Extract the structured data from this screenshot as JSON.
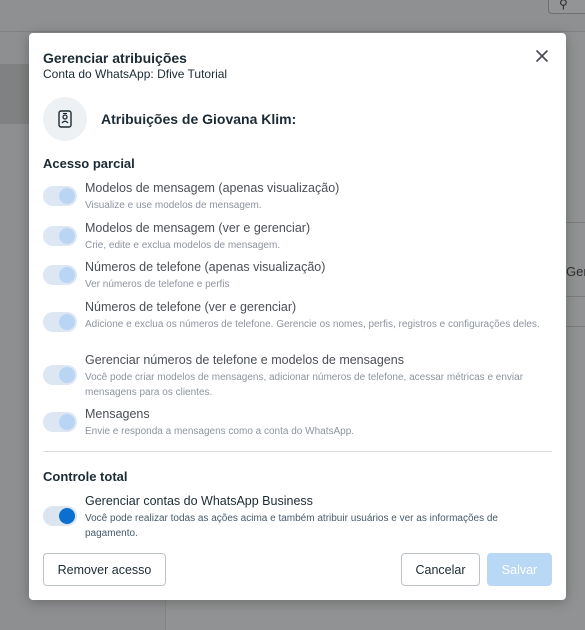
{
  "background": {
    "search_icon": "search-icon",
    "right_text": "Gerenc"
  },
  "modal": {
    "title": "Gerenciar atribuições",
    "subtitle": "Conta do WhatsApp: Dfive Tutorial",
    "close_icon": "close-icon",
    "avatar_icon": "id-badge-icon",
    "user_heading": "Atribuições de Giovana Klim:",
    "partial_access": {
      "title": "Acesso parcial",
      "items": [
        {
          "label": "Modelos de mensagem (apenas visualização)",
          "description": "Visualize e use modelos de mensagem.",
          "enabled": true
        },
        {
          "label": "Modelos de mensagem (ver e gerenciar)",
          "description": "Crie, edite e exclua modelos de mensagem.",
          "enabled": true
        },
        {
          "label": "Números de telefone (apenas visualização)",
          "description": "Ver números de telefone e perfis",
          "enabled": true
        },
        {
          "label": "Números de telefone (ver e gerenciar)",
          "description": "Adicione e exclua os números de telefone. Gerencie os nomes, perfis, registros e configurações deles.",
          "enabled": true
        },
        {
          "label": "Gerenciar números de telefone e modelos de mensagens",
          "description": "Você pode criar modelos de mensagens, adicionar números de telefone, acessar métricas e enviar mensagens para os clientes.",
          "enabled": true
        },
        {
          "label": "Mensagens",
          "description": "Envie e responda a mensagens como a conta do WhatsApp.",
          "enabled": true
        }
      ]
    },
    "full_control": {
      "title": "Controle total",
      "items": [
        {
          "label": "Gerenciar contas do WhatsApp Business",
          "description": "Você pode realizar todas as ações acima e também atribuir usuários e ver as informações de pagamento.",
          "enabled": true
        }
      ]
    },
    "buttons": {
      "remove": "Remover acesso",
      "cancel": "Cancelar",
      "save": "Salvar"
    }
  },
  "colors": {
    "accent": "#0a6fd1",
    "disabled_toggle": "#dce7f3",
    "save_disabled": "#b9d8f5"
  }
}
